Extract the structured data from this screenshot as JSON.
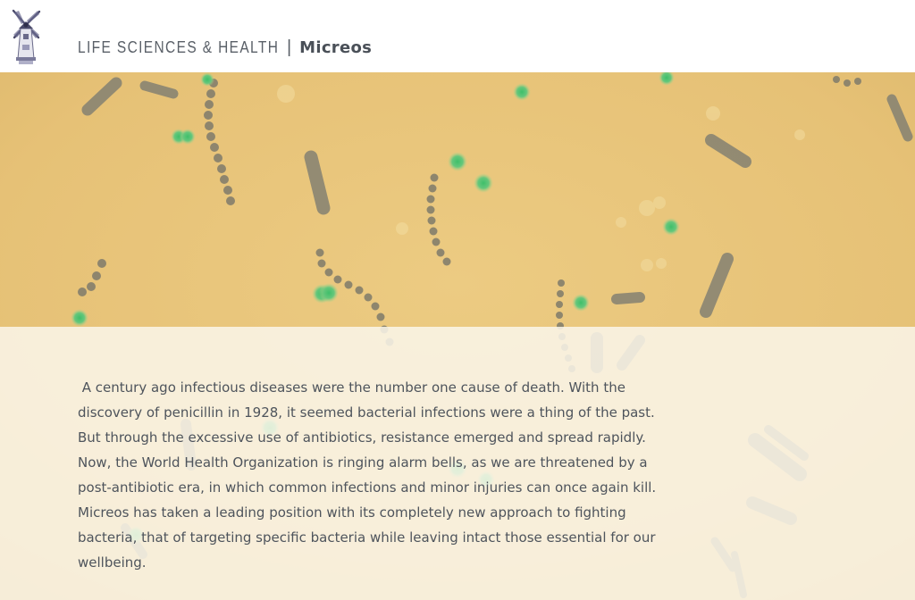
{
  "header": {
    "logo_icon": "windmill-icon",
    "section_title": "LIFE SCIENCES & HEALTH",
    "separator": "|",
    "company_name": "Micreos"
  },
  "hero": {
    "image_icon": "bacteria-microscope-image",
    "colors": {
      "background": "#e9c47a",
      "rod": "#8a8470",
      "green_cell": "#57c07a"
    }
  },
  "body": {
    "lines": [
      " A century ago infectious diseases were the number one cause of death. With the",
      "discovery of penicillin in 1928, it seemed bacterial infections were a thing of the past.",
      "But through the excessive use of antibiotics, resistance emerged and spread rapidly.",
      "Now, the World Health Organization is ringing alarm bells, as we are threatened by a",
      "post-antibiotic era, in which common infections and minor injuries can once again kill.",
      "Micreos has taken a leading position with its completely new approach to fighting",
      "bacteria, that of targeting specific bacteria while leaving intact those essential for our",
      "wellbeing."
    ]
  }
}
